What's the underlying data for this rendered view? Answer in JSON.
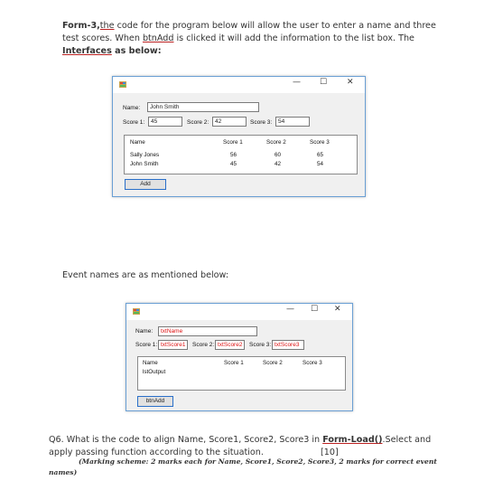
{
  "intro": {
    "label": "Form-3,",
    "link_the": "the",
    "line1_rest": " code for the program below will allow the user to enter a name and three",
    "line2_a": "test scores. When ",
    "btn_name": "btnAdd",
    "line2_b": " is clicked it will add the information to the list box. The",
    "interfaces": "Interfaces",
    "line3_rest": " as below:"
  },
  "window1": {
    "minimize": "—",
    "maximize": "☐",
    "close": "✕",
    "name_label": "Name:",
    "name_value": "John Smith",
    "score1_label": "Score 1:",
    "score1_value": "45",
    "score2_label": "Score 2:",
    "score2_value": "42",
    "score3_label": "Score 3:",
    "score3_value": "54",
    "list_headers": [
      "Name",
      "Score 1",
      "Score 2",
      "Score 3"
    ],
    "list_rows": [
      [
        "Sally Jones",
        "56",
        "60",
        "65"
      ],
      [
        "John Smith",
        "45",
        "42",
        "54"
      ]
    ],
    "add_button": "Add"
  },
  "event_text": "Event names are as mentioned below:",
  "window2": {
    "minimize": "—",
    "maximize": "☐",
    "close": "✕",
    "name_label": "Name:",
    "name_value": "txtName",
    "score1_label": "Score 1:",
    "score1_value": "txtScore1",
    "score2_label": "Score 2:",
    "score2_value": "txtScore2",
    "score3_label": "Score 3:",
    "score3_value": "txtScore3",
    "list_headers": [
      "Name",
      "Score 1",
      "Score 2",
      "Score 3"
    ],
    "list_name": "lstOutput",
    "add_button": "btnAdd"
  },
  "question": {
    "q_a": "Q6. What is the code to align Name, Score1, Score2, Score3 in ",
    "form_load": "Form-Load()",
    "q_b": ".Select and",
    "line2": "apply passing function according to the situation.",
    "marks": "[10]",
    "scheme_line1": "(Marking scheme: 2 marks each for Name, Score1, Score2, Score3, 2 marks for correct event",
    "scheme_line2": "names)"
  },
  "colors": {
    "window_border": "#6a9fd4",
    "button_border": "#2a6fc9",
    "control_text_red": "#dd1111"
  }
}
